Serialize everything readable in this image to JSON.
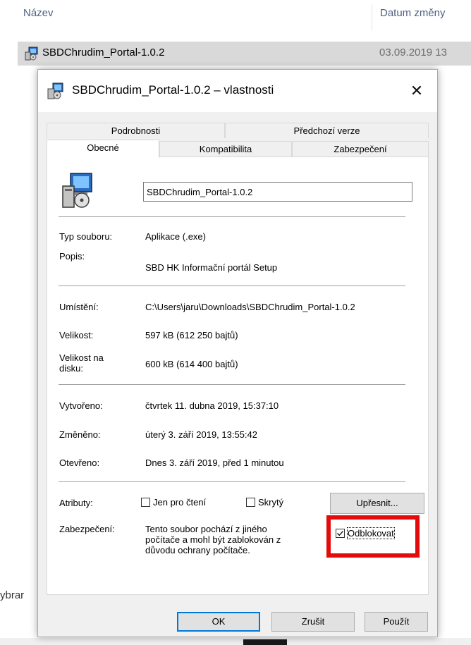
{
  "explorer": {
    "col_name": "Název",
    "col_date": "Datum změny",
    "file_name": "SBDChrudim_Portal-1.0.2",
    "file_date": "03.09.2019 13",
    "left_fragment": "ybrar"
  },
  "dialog": {
    "title": "SBDChrudim_Portal-1.0.2 – vlastnosti",
    "close_glyph": "✕",
    "tabs_row1": [
      "Podrobnosti",
      "Předchozí verze"
    ],
    "tabs_row2": [
      "Obecné",
      "Kompatibilita",
      "Zabezpečení"
    ],
    "active_tab": "Obecné",
    "filename_value": "SBDChrudim_Portal-1.0.2",
    "props": {
      "type_label": "Typ souboru:",
      "type_value": "Aplikace (.exe)",
      "desc_label": "Popis:",
      "desc_value": "SBD HK Informační portál Setup",
      "location_label": "Umístění:",
      "location_value": "C:\\Users\\jaru\\Downloads\\SBDChrudim_Portal-1.0.2",
      "size_label": "Velikost:",
      "size_value": "597 kB (612 250 bajtů)",
      "disksize_label": "Velikost na disku:",
      "disksize_value": "600 kB (614 400 bajtů)",
      "created_label": "Vytvořeno:",
      "created_value": "čtvrtek 11. dubna 2019, 15:37:10",
      "modified_label": "Změněno:",
      "modified_value": "úterý 3. září 2019, 13:55:42",
      "opened_label": "Otevřeno:",
      "opened_value": "Dnes 3. září 2019, před 1 minutou"
    },
    "attributes": {
      "label": "Atributy:",
      "readonly": "Jen pro čtení",
      "readonly_checked": false,
      "hidden": "Skrytý",
      "hidden_checked": false,
      "advanced": "Upřesnit..."
    },
    "security": {
      "label": "Zabezpečení:",
      "text": "Tento soubor pochází z jiného počítače a mohl být zablokován z důvodu ochrany počítače.",
      "unblock": "Odblokovat",
      "unblock_checked": true
    },
    "buttons": {
      "ok": "OK",
      "cancel": "Zrušit",
      "apply": "Použít"
    }
  },
  "colors": {
    "highlight": "#e30b0b",
    "accent": "#0078d7"
  },
  "icons": [
    "setup-app-icon",
    "close-icon",
    "checkbox-icon",
    "checkmark-icon"
  ]
}
